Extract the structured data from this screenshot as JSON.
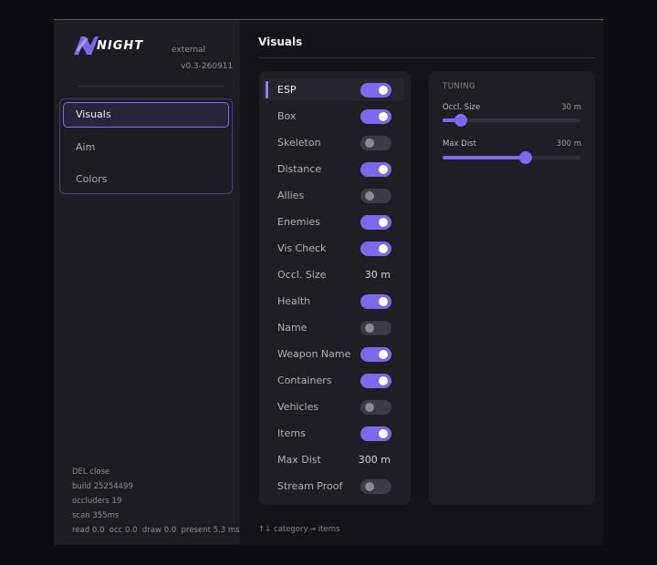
{
  "brand": {
    "logo_text": "NIGHT",
    "subtitle": "external",
    "version": "v0.3-260911"
  },
  "nav": [
    {
      "label": "Visuals",
      "active": true
    },
    {
      "label": "Aim",
      "active": false
    },
    {
      "label": "Colors",
      "active": false
    }
  ],
  "footer": {
    "close_hint": "DEL close",
    "build": "build 25254499",
    "occluders": "occluders 19",
    "scan": "scan 355ms",
    "timings": "read 0.0  occ 0.0  draw 0.0  present 5.3 ms"
  },
  "section_title": "Visuals",
  "options": [
    {
      "label": "ESP",
      "type": "toggle",
      "on": true,
      "selected": true
    },
    {
      "label": "Box",
      "type": "toggle",
      "on": true
    },
    {
      "label": "Skeleton",
      "type": "toggle",
      "on": false
    },
    {
      "label": "Distance",
      "type": "toggle",
      "on": true
    },
    {
      "label": "Allies",
      "type": "toggle",
      "on": false
    },
    {
      "label": "Enemies",
      "type": "toggle",
      "on": true
    },
    {
      "label": "Vis Check",
      "type": "toggle",
      "on": true
    },
    {
      "label": "Occl. Size",
      "type": "value",
      "value": "30 m"
    },
    {
      "label": "Health",
      "type": "toggle",
      "on": true
    },
    {
      "label": "Name",
      "type": "toggle",
      "on": false
    },
    {
      "label": "Weapon Name",
      "type": "toggle",
      "on": true
    },
    {
      "label": "Containers",
      "type": "toggle",
      "on": true
    },
    {
      "label": "Vehicles",
      "type": "toggle",
      "on": false
    },
    {
      "label": "Items",
      "type": "toggle",
      "on": true
    },
    {
      "label": "Max Dist",
      "type": "value",
      "value": "300 m"
    },
    {
      "label": "Stream Proof",
      "type": "toggle",
      "on": false
    }
  ],
  "tuning": {
    "title": "TUNING",
    "sliders": [
      {
        "label": "Occl. Size",
        "value": "30 m",
        "fraction": 0.13
      },
      {
        "label": "Max Dist",
        "value": "300 m",
        "fraction": 0.6
      }
    ]
  },
  "hints": {
    "category": "↑↓ category",
    "items": "→ items"
  },
  "colors": {
    "accent": "#7b68ea",
    "background": "#0e0e12",
    "sidebar": "#1c1c22",
    "panel": "#1e1e24"
  }
}
